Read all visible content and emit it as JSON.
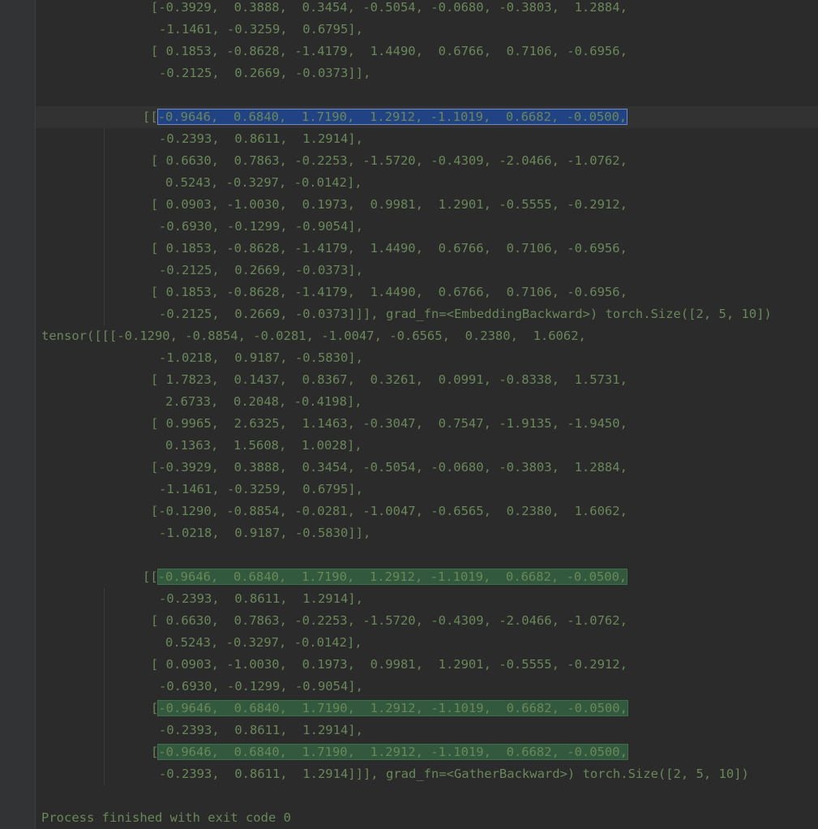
{
  "console": {
    "lines": [
      {
        "indent": 142,
        "text": "[-0.3929,  0.3888,  0.3454, -0.5054, -0.0680, -0.3803,  1.2884,"
      },
      {
        "indent": 152,
        "text": "-1.1461, -0.3259,  0.6795],"
      },
      {
        "indent": 142,
        "text": "[ 0.1853, -0.8628, -1.4179,  1.4490,  0.6766,  0.7106, -0.6956,"
      },
      {
        "indent": 152,
        "text": "-0.2125,  0.2669, -0.0373]],"
      },
      {
        "indent": 0,
        "text": ""
      },
      {
        "indent": 132,
        "text": "[[",
        "sel": "-0.9646,  0.6840,  1.7190,  1.2912, -1.1019,  0.6682, -0.0500,",
        "selType": "blue",
        "current": true
      },
      {
        "indent": 152,
        "text": "-0.2393,  0.8611,  1.2914],"
      },
      {
        "indent": 142,
        "text": "[ 0.6630,  0.7863, -0.2253, -1.5720, -0.4309, -2.0466, -1.0762,"
      },
      {
        "indent": 160,
        "text": "0.5243, -0.3297, -0.0142],"
      },
      {
        "indent": 142,
        "text": "[ 0.0903, -1.0030,  0.1973,  0.9981,  1.2901, -0.5555, -0.2912,"
      },
      {
        "indent": 152,
        "text": "-0.6930, -0.1299, -0.9054],"
      },
      {
        "indent": 142,
        "text": "[ 0.1853, -0.8628, -1.4179,  1.4490,  0.6766,  0.7106, -0.6956,"
      },
      {
        "indent": 152,
        "text": "-0.2125,  0.2669, -0.0373],"
      },
      {
        "indent": 142,
        "text": "[ 0.1853, -0.8628, -1.4179,  1.4490,  0.6766,  0.7106, -0.6956,"
      },
      {
        "indent": 152,
        "text": "-0.2125,  0.2669, -0.0373]]], grad_fn=<EmbeddingBackward>) torch.Size([2, 5, 10])"
      },
      {
        "indent": 7,
        "text": "tensor([[[-0.1290, -0.8854, -0.0281, -1.0047, -0.6565,  0.2380,  1.6062,"
      },
      {
        "indent": 152,
        "text": "-1.0218,  0.9187, -0.5830],"
      },
      {
        "indent": 142,
        "text": "[ 1.7823,  0.1437,  0.8367,  0.3261,  0.0991, -0.8338,  1.5731,"
      },
      {
        "indent": 160,
        "text": "2.6733,  0.2048, -0.4198],"
      },
      {
        "indent": 142,
        "text": "[ 0.9965,  2.6325,  1.1463, -0.3047,  0.7547, -1.9135, -1.9450,"
      },
      {
        "indent": 160,
        "text": "0.1363,  1.5608,  1.0028],"
      },
      {
        "indent": 142,
        "text": "[-0.3929,  0.3888,  0.3454, -0.5054, -0.0680, -0.3803,  1.2884,"
      },
      {
        "indent": 152,
        "text": "-1.1461, -0.3259,  0.6795],"
      },
      {
        "indent": 142,
        "text": "[-0.1290, -0.8854, -0.0281, -1.0047, -0.6565,  0.2380,  1.6062,"
      },
      {
        "indent": 152,
        "text": "-1.0218,  0.9187, -0.5830]],"
      },
      {
        "indent": 0,
        "text": ""
      },
      {
        "indent": 132,
        "text": "[[",
        "sel": "-0.9646,  0.6840,  1.7190,  1.2912, -1.1019,  0.6682, -0.0500,",
        "selType": "green"
      },
      {
        "indent": 152,
        "text": "-0.2393,  0.8611,  1.2914],"
      },
      {
        "indent": 142,
        "text": "[ 0.6630,  0.7863, -0.2253, -1.5720, -0.4309, -2.0466, -1.0762,"
      },
      {
        "indent": 160,
        "text": "0.5243, -0.3297, -0.0142],"
      },
      {
        "indent": 142,
        "text": "[ 0.0903, -1.0030,  0.1973,  0.9981,  1.2901, -0.5555, -0.2912,"
      },
      {
        "indent": 152,
        "text": "-0.6930, -0.1299, -0.9054],"
      },
      {
        "indent": 142,
        "text": "[",
        "sel": "-0.9646,  0.6840,  1.7190,  1.2912, -1.1019,  0.6682, -0.0500,",
        "selType": "green"
      },
      {
        "indent": 152,
        "text": "-0.2393,  0.8611,  1.2914],"
      },
      {
        "indent": 142,
        "text": "[",
        "sel": "-0.9646,  0.6840,  1.7190,  1.2912, -1.1019,  0.6682, -0.0500,",
        "selType": "green"
      },
      {
        "indent": 152,
        "text": "-0.2393,  0.8611,  1.2914]]], grad_fn=<GatherBackward>) torch.Size([2, 5, 10])"
      },
      {
        "indent": 0,
        "text": ""
      },
      {
        "indent": 7,
        "text": "Process finished with exit code 0"
      }
    ]
  },
  "colors": {
    "background": "#2b2b2b",
    "text": "#6a8759",
    "selection_blue": "#214283",
    "selection_green": "#32593d"
  }
}
